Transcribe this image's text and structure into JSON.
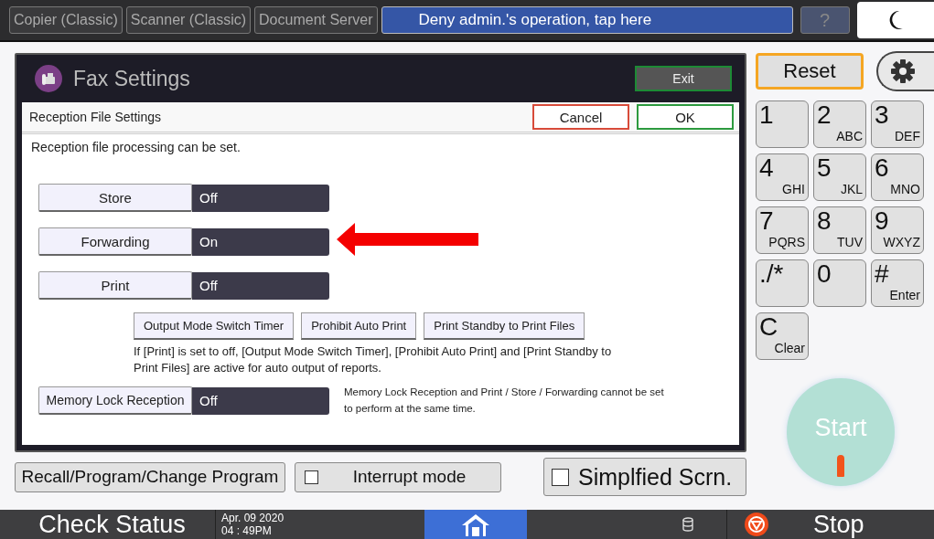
{
  "top_tabs": [
    "Copier (Classic)",
    "Scanner (Classic)",
    "Document Server"
  ],
  "notice": "Deny admin.'s operation, tap here",
  "help_button": "?",
  "fax": {
    "title": "Fax Settings",
    "exit": "Exit",
    "panel": {
      "title": "Reception File Settings",
      "cancel": "Cancel",
      "ok": "OK",
      "description": "Reception file processing can be set.",
      "settings": [
        {
          "label": "Store",
          "value": "Off"
        },
        {
          "label": "Forwarding",
          "value": "On"
        },
        {
          "label": "Print",
          "value": "Off"
        }
      ],
      "sub_buttons": [
        "Output Mode Switch Timer",
        "Prohibit Auto Print",
        "Print Standby to Print Files"
      ],
      "note": "If [Print] is set to off, [Output Mode Switch Timer], [Prohibit Auto Print] and [Print Standby to Print Files] are active for auto output of reports.",
      "memory_lock": {
        "label": "Memory Lock Reception",
        "value": "Off",
        "note": "Memory Lock Reception and Print / Store / Forwarding cannot be set to perform at the same time."
      }
    }
  },
  "bottom_buttons": {
    "recall": "Recall/Program/Change Program",
    "interrupt": {
      "label": "Interrupt mode",
      "checked": false
    },
    "simplified": {
      "label": "Simplfied Scrn.",
      "checked": false
    }
  },
  "reset": "Reset",
  "keypad": [
    {
      "main": "1"
    },
    {
      "main": "2",
      "sub": "ABC"
    },
    {
      "main": "3",
      "sub": "DEF"
    },
    {
      "main": "4",
      "sub": "GHI"
    },
    {
      "main": "5",
      "sub": "JKL"
    },
    {
      "main": "6",
      "sub": "MNO"
    },
    {
      "main": "7",
      "sub": "PQRS"
    },
    {
      "main": "8",
      "sub": "TUV"
    },
    {
      "main": "9",
      "sub": "WXYZ"
    },
    {
      "main": "./*"
    },
    {
      "main": "0"
    },
    {
      "main": "#",
      "sub": "Enter"
    },
    {
      "main": "C",
      "sub": "Clear"
    }
  ],
  "start": "Start",
  "status_bar": {
    "check_status": "Check Status",
    "date": "Apr. 09 2020",
    "time": "04 : 49PM",
    "stop": "Stop"
  }
}
